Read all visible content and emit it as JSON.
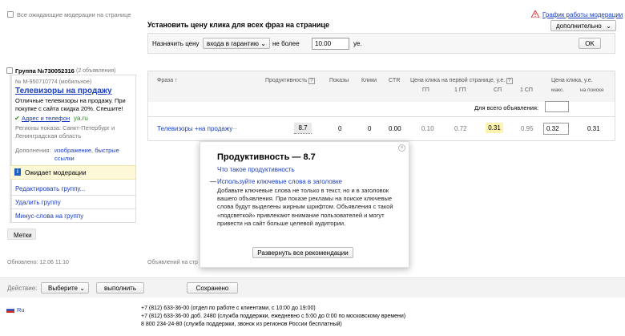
{
  "top_left": {
    "checkbox_label": "Все ожидающие модерации на странице"
  },
  "schedule": {
    "link": "График работы модерации",
    "dropdown": "дополнительно"
  },
  "set_price": {
    "title": "Установить цену клика для всех фраз на странице",
    "label_assign": "Назначить цену",
    "select_value": "входа в гарантию",
    "label_max": "не более",
    "value": "10.00",
    "unit": "уе.",
    "ok": "OK"
  },
  "group": {
    "title": "Группа №730052316",
    "ad_count": "(2 объявления)",
    "ad_number": "№ М-950710774 (мобильное)",
    "ad_title": "Телевизоры на продажу",
    "ad_text": "Отличные телевизоры на продажу. При покупке с сайта скидка 20%. Спешите!",
    "ad_links": "Адрес и телефон",
    "ad_domain": "ya.ru",
    "regions": "Регионы показа: Санкт-Петербург и Ленинградская область",
    "extras_label": "Дополнения:",
    "extras_links": "изображение, быстрые ссылки",
    "status": "Ожидает модерации",
    "edit": "Редактировать группу...",
    "delete": "Удалить группу",
    "minus": "Минус-слова на группу",
    "tags": "Метки"
  },
  "table": {
    "headers": {
      "phrase": "Фраза",
      "productivity": "Продуктивность",
      "impressions": "Показы",
      "clicks": "Клики",
      "ctr": "CTR",
      "first_page": "Цена клика на первой странице, у.е.",
      "gp": "ГП",
      "gp1": "1 ГП",
      "sp": "СП",
      "sp1": "1 СП",
      "click_price": "Цена клика, у.е.",
      "max": "макс.",
      "search": "на поиске"
    },
    "all_ads_label": "Для всего объявления:",
    "row": {
      "phrase": "Телевизоры +на продажу",
      "ellipsis": "···",
      "productivity": "8.7",
      "impressions": "0",
      "clicks": "0",
      "ctr": "0.00",
      "gp": "0.10",
      "gp1": "0.72",
      "sp": "0.31",
      "sp1": "0.95",
      "max": "0.32",
      "search": "0.31"
    }
  },
  "popup": {
    "title": "Продуктивность — 8.7",
    "what_link": "Что такое продуктивность",
    "dash": "—",
    "rec_link": "Используйте ключевые слова в заголовке",
    "rec_text": "Добавьте ключевые слова не только в текст, но и в заголовок вашего объявления. При показе рекламы на поиске ключевые слова будут выделены жирным шрифтом. Объявления с такой «подсветкой» привлекают внимание пользователей и могут привести на сайт больше целевой аудитории.",
    "expand_btn": "Развернуть все рекомендации"
  },
  "updated": "Обновлено: 12.06 11:10",
  "ads_on_page": "Объявлений на стр",
  "actions": {
    "label": "Действие:",
    "select": "Выберите",
    "run": "выполнить",
    "saved": "Сохранено"
  },
  "footer": {
    "lang": "Ru",
    "phone1": "+7 (812) 633-36-00 (отдел по работе с клиентами, с 10:00 до 19:00)",
    "phone2": "+7 (812) 633-36-00 доб. 2480 (служба поддержки, ежедневно с 5:00 до 0:00 по московскому времени)",
    "phone3": "8 800 234-24-80 (служба поддержки, звонок из регионов России бесплатный)"
  },
  "colors": {
    "link": "#1a3dc1",
    "highlight_yellow": "#fff3b0",
    "status_bg": "#fdf8d8"
  }
}
